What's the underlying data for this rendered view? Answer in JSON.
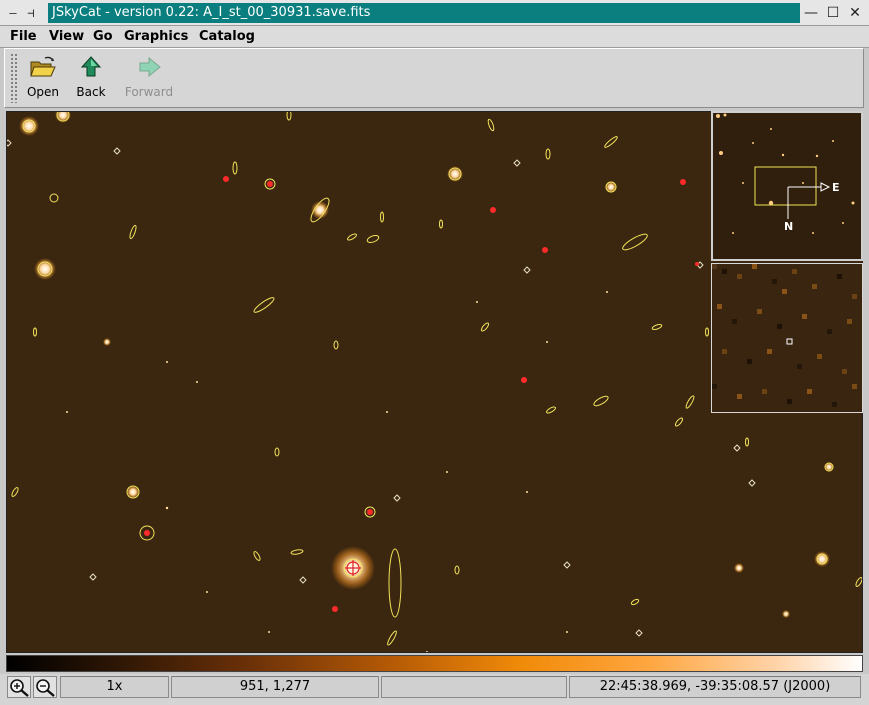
{
  "window": {
    "title": "JSkyCat - version 0.22: A_I_st_00_30931.save.fits",
    "left_glyphs": [
      "—",
      "⊣"
    ],
    "min_glyph": "—",
    "max_glyph": "☐",
    "close_glyph": "✕"
  },
  "menubar": {
    "items": [
      "File",
      "View",
      "Go",
      "Graphics",
      "Catalog"
    ]
  },
  "toolbar": {
    "open_label": "Open",
    "back_label": "Back",
    "forward_label": "Forward"
  },
  "panner": {
    "east_label": "E",
    "north_label": "N"
  },
  "colormap": {
    "name": "heat",
    "accent_colors": [
      "#000000",
      "#f08a08",
      "#ffffff"
    ]
  },
  "statusbar": {
    "zoom_level": "1x",
    "pixel_coords": "951, 1,277",
    "pixel_value": "",
    "world_coords": "22:45:38.969, -39:35:08.57 (J2000)"
  },
  "colors": {
    "title_bg": "#0b7f7f",
    "image_bg": "#3b2710",
    "overlay": "#f2e35a",
    "selected_object": "#ff2a2a"
  }
}
